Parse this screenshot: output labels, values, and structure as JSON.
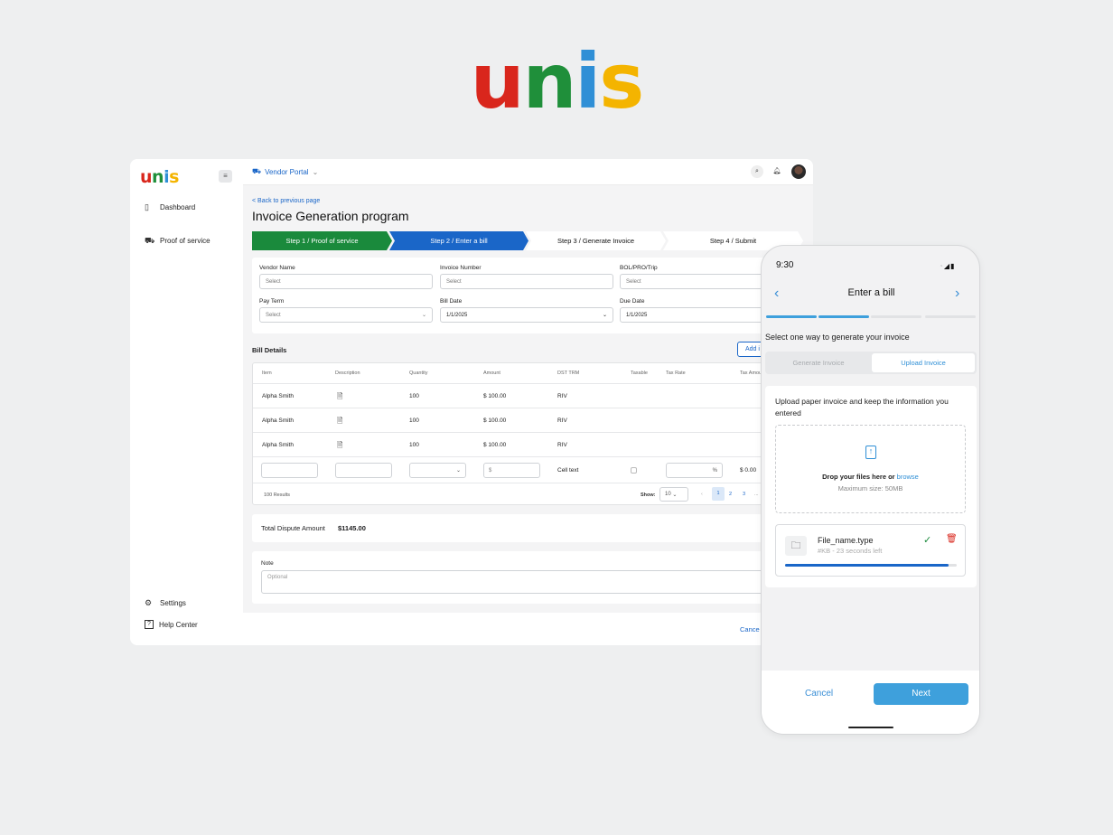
{
  "brand": {
    "u": "u",
    "n": "n",
    "i": "i",
    "s": "s",
    "colors": {
      "u": "#d9261c",
      "n": "#1f8f3a",
      "i": "#2f8fd6",
      "s": "#f4b400"
    }
  },
  "sidebar": {
    "collapse_icon": "sidebar-collapse-icon",
    "items": [
      {
        "label": "Dashboard",
        "icon": "map-icon"
      },
      {
        "label": "Proof of service",
        "icon": "truck-icon"
      }
    ],
    "bottom": [
      {
        "label": "Settings",
        "icon": "gear-icon"
      },
      {
        "label": "Help Center",
        "icon": "help-icon"
      }
    ]
  },
  "topbar": {
    "portal": "Vendor Portal"
  },
  "page": {
    "back": "< Back to previous page",
    "title": "Invoice Generation program"
  },
  "steps": [
    {
      "label": "Step 1 / Proof of service",
      "state": "done",
      "color": "#1a8a3c"
    },
    {
      "label": "Step 2 / Enter a bill",
      "state": "active",
      "color": "#1a66c8"
    },
    {
      "label": "Step 3 / Generate Invoice",
      "state": "todo"
    },
    {
      "label": "Step 4 / Submit",
      "state": "todo"
    }
  ],
  "form": {
    "vendor_name": {
      "label": "Vendor Name",
      "value": "Select"
    },
    "invoice_number": {
      "label": "Invoice Number",
      "value": "Select"
    },
    "bol": {
      "label": "BOL/PRO/Trip",
      "value": "Select"
    },
    "pay_term": {
      "label": "Pay Term",
      "value": "Select"
    },
    "bill_date": {
      "label": "Bill Date",
      "value": "1/1/2025"
    },
    "due_date": {
      "label": "Due Date",
      "value": "1/1/2025"
    }
  },
  "bill": {
    "title": "Bill Details",
    "add_label": "Add i",
    "columns": [
      "Item",
      "Description",
      "Quantity",
      "Amount",
      "DST TRM",
      "Taxable",
      "Tax Rate",
      "Tax Amou"
    ],
    "rows": [
      {
        "item": "Alpha Smith",
        "quantity": "100",
        "amount": "$ 100.00",
        "dst": "RIV"
      },
      {
        "item": "Alpha Smith",
        "quantity": "100",
        "amount": "$ 100.00",
        "dst": "RIV"
      },
      {
        "item": "Alpha Smith",
        "quantity": "100",
        "amount": "$ 100.00",
        "dst": "RIV"
      }
    ],
    "edit_row": {
      "amount_prefix": "$",
      "dst": "Cell text",
      "tax_suffix": "%",
      "tax_amount": "$ 0.00"
    },
    "results": "100 Results",
    "show_label": "Show:",
    "show_value": "10",
    "pages": [
      "1",
      "2",
      "3",
      "..."
    ]
  },
  "total": {
    "label": "Total Dispute Amount",
    "value": "$1145.00"
  },
  "note": {
    "label": "Note",
    "placeholder": "Optional"
  },
  "footer": {
    "cancel": "Cance"
  },
  "phone": {
    "time": "9:30",
    "title": "Enter a bill",
    "progress": {
      "steps": 4,
      "completed": 2
    },
    "subtitle": "Select one way to generate your invoice",
    "options": [
      "Generate Invoice",
      "Upload Invoice"
    ],
    "selected_option": "Upload Invoice",
    "upload_text": "Upload paper invoice and keep the information you entered",
    "drop_text": "Drop your files here or",
    "browse": "browse",
    "max_size": "Maximum size: 50MB",
    "file_name": "File_name.type",
    "file_meta": "#KB - 23 seconds left",
    "file_progress": 0.95,
    "cancel": "Cancel",
    "next": "Next"
  }
}
